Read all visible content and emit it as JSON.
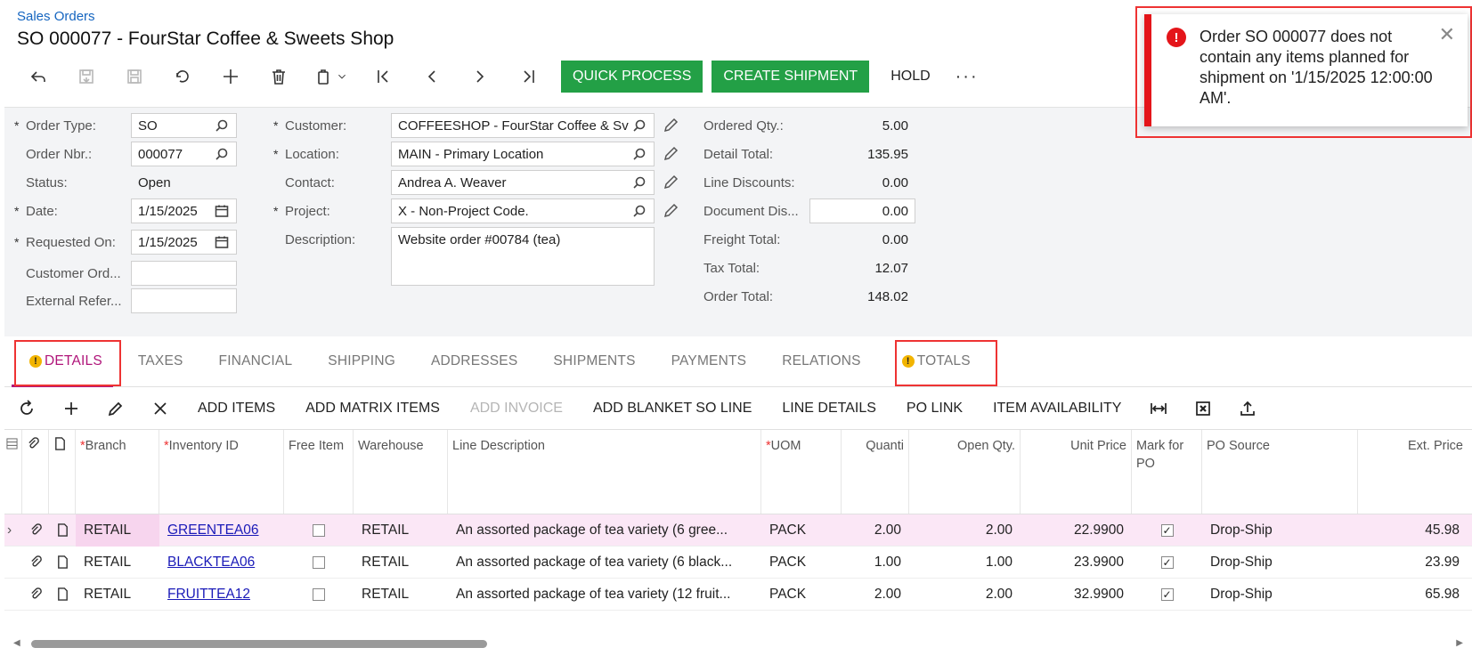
{
  "breadcrumb": "Sales Orders",
  "title": "SO 000077 - FourStar Coffee & Sweets Shop",
  "toolbar": {
    "icons": [
      "back-icon",
      "save-close-icon",
      "save-icon",
      "undo-icon",
      "add-icon",
      "delete-icon",
      "copy-paste-icon",
      "first-record-icon",
      "prev-record-icon",
      "next-record-icon",
      "last-record-icon"
    ],
    "quick_process": "QUICK PROCESS",
    "create_shipment": "CREATE SHIPMENT",
    "hold": "HOLD",
    "more": "···"
  },
  "form": {
    "order_type_label": "Order Type:",
    "order_type": "SO",
    "order_nbr_label": "Order Nbr.:",
    "order_nbr": "000077",
    "status_label": "Status:",
    "status": "Open",
    "date_label": "Date:",
    "date": "1/15/2025",
    "requested_on_label": "Requested On:",
    "requested_on": "1/15/2025",
    "customer_ord_label": "Customer Ord...",
    "customer_ord": "",
    "external_ref_label": "External Refer...",
    "external_ref": "",
    "customer_label": "Customer:",
    "customer": "COFFEESHOP - FourStar Coffee & Sv",
    "location_label": "Location:",
    "location": "MAIN - Primary Location",
    "contact_label": "Contact:",
    "contact": "Andrea A. Weaver",
    "project_label": "Project:",
    "project": "X - Non-Project Code.",
    "description_label": "Description:",
    "description": "Website order #00784 (tea)"
  },
  "totals": {
    "ordered_qty_label": "Ordered Qty.:",
    "ordered_qty": "5.00",
    "detail_total_label": "Detail Total:",
    "detail_total": "135.95",
    "line_discounts_label": "Line Discounts:",
    "line_discounts": "0.00",
    "document_dis_label": "Document Dis...",
    "document_dis": "0.00",
    "freight_total_label": "Freight Total:",
    "freight_total": "0.00",
    "tax_total_label": "Tax Total:",
    "tax_total": "12.07",
    "order_total_label": "Order Total:",
    "order_total": "148.02"
  },
  "tabs": [
    "DETAILS",
    "TAXES",
    "FINANCIAL",
    "SHIPPING",
    "ADDRESSES",
    "SHIPMENTS",
    "PAYMENTS",
    "RELATIONS",
    "TOTALS"
  ],
  "grid_toolbar": {
    "add_items": "ADD ITEMS",
    "add_matrix_items": "ADD MATRIX ITEMS",
    "add_invoice": "ADD INVOICE",
    "add_blanket": "ADD BLANKET SO LINE",
    "line_details": "LINE DETAILS",
    "po_link": "PO LINK",
    "item_availability": "ITEM AVAILABILITY"
  },
  "grid": {
    "headers": {
      "branch": "Branch",
      "inventory_id": "Inventory ID",
      "free_item": "Free Item",
      "warehouse": "Warehouse",
      "line_description": "Line Description",
      "uom": "UOM",
      "quantity": "Quanti",
      "open_qty": "Open Qty.",
      "unit_price": "Unit Price",
      "mark_for_po": "Mark for PO",
      "po_source": "PO Source",
      "ext_price": "Ext. Price"
    },
    "rows": [
      {
        "branch": "RETAIL",
        "inventory_id": "GREENTEA06",
        "warehouse": "RETAIL",
        "description": "An assorted package of tea variety (6 gree...",
        "uom": "PACK",
        "qty": "2.00",
        "open_qty": "2.00",
        "unit_price": "22.9900",
        "po_source": "Drop-Ship",
        "ext_price": "45.98"
      },
      {
        "branch": "RETAIL",
        "inventory_id": "BLACKTEA06",
        "warehouse": "RETAIL",
        "description": "An assorted package of tea variety (6 black...",
        "uom": "PACK",
        "qty": "1.00",
        "open_qty": "1.00",
        "unit_price": "23.9900",
        "po_source": "Drop-Ship",
        "ext_price": "23.99"
      },
      {
        "branch": "RETAIL",
        "inventory_id": "FRUITTEA12",
        "warehouse": "RETAIL",
        "description": "An assorted package of tea variety (12 fruit...",
        "uom": "PACK",
        "qty": "2.00",
        "open_qty": "2.00",
        "unit_price": "32.9900",
        "po_source": "Drop-Ship",
        "ext_price": "65.98"
      }
    ]
  },
  "toast": {
    "message": "Order SO 000077 does not contain any items planned for shipment on '1/15/2025 12:00:00 AM'.",
    "close": "✕"
  },
  "colors": {
    "accent_green": "#23a046",
    "active_tab": "#b0157a",
    "error_red": "#e4151a",
    "warning_yellow": "#f2b400",
    "link_blue": "#1565c0"
  }
}
